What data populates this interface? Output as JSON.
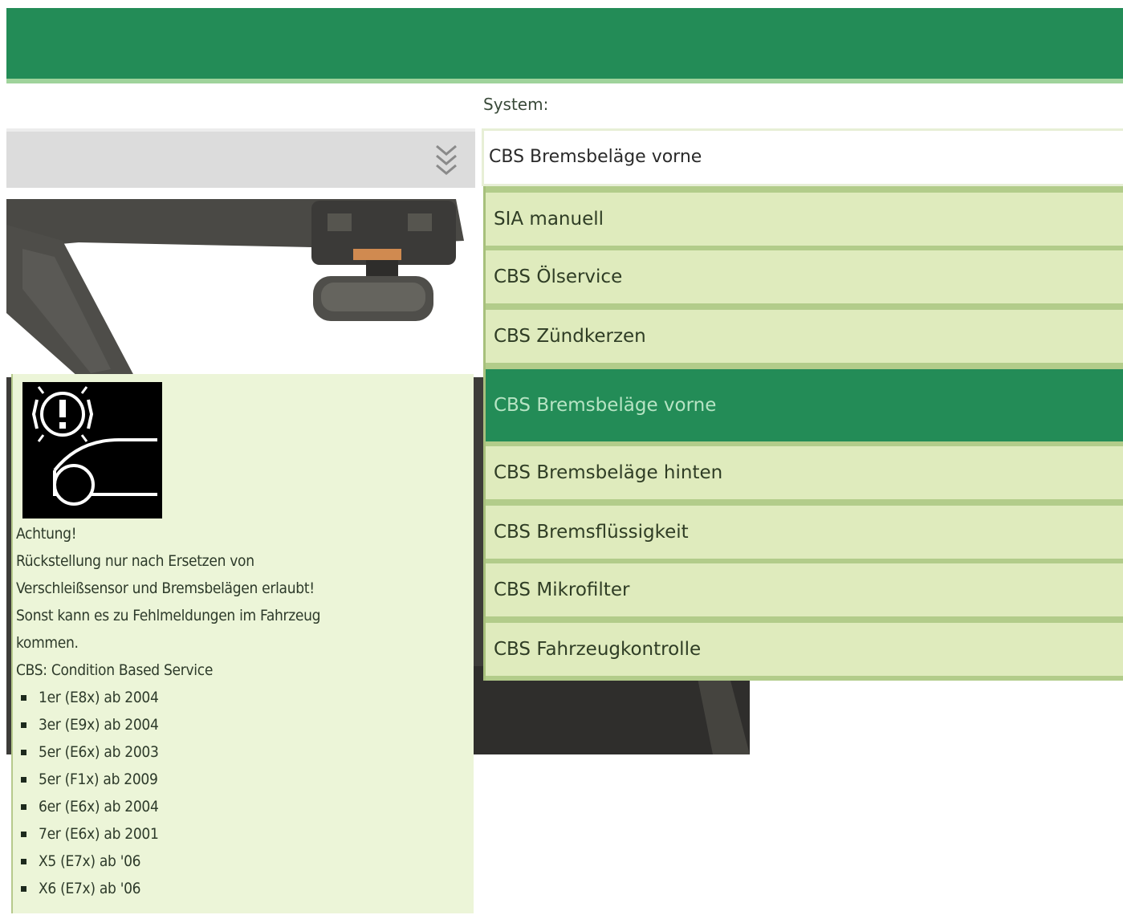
{
  "header": {
    "accent_color": "#238c57"
  },
  "left_select": {
    "value": "",
    "icon": "double-chevron-down-icon"
  },
  "info_panel": {
    "warning_icon": "brake-pad-warning-icon",
    "lines": [
      "Achtung!",
      "Rückstellung nur nach Ersetzen von",
      "Verschleißsensor und Bremsbelägen erlaubt!",
      "Sonst kann es zu Fehlmeldungen im Fahrzeug",
      "kommen.",
      "CBS: Condition Based Service"
    ],
    "models": [
      "1er (E8x) ab 2004",
      "3er (E9x) ab 2004",
      "5er (E6x) ab 2003",
      "5er (F1x) ab 2009",
      "6er (E6x) ab 2004",
      "7er (E6x) ab 2001",
      "X5 (E7x) ab '06",
      "X6 (E7x) ab '06"
    ]
  },
  "system": {
    "label": "System:",
    "selected_value": "CBS Bremsbeläge vorne",
    "options": [
      "SIA manuell",
      "CBS Ölservice",
      "CBS Zündkerzen",
      "CBS Bremsbeläge vorne",
      "CBS Bremsbeläge hinten",
      "CBS Bremsflüssigkeit",
      "CBS Mikrofilter",
      "CBS Fahrzeugkontrolle"
    ],
    "selected_index": 3
  },
  "colors": {
    "brand_green": "#238c57",
    "option_bg": "#dfebbd",
    "panel_bg": "#ecf5d8"
  }
}
